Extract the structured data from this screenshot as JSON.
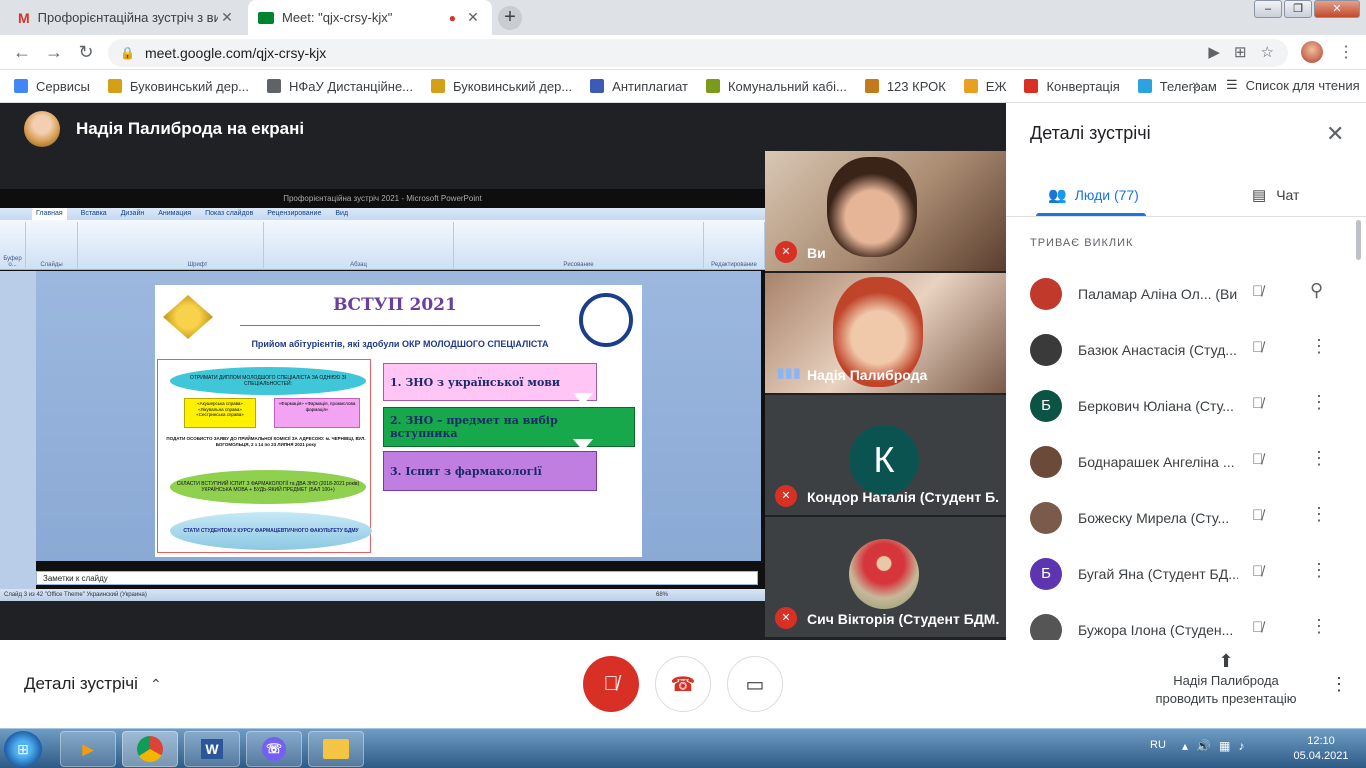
{
  "tabs": [
    {
      "title": "Профорієнтаційна зустріч з ви",
      "close": "✕"
    },
    {
      "title": "Meet: \"qjx-crsy-kjx\"",
      "close": "✕"
    }
  ],
  "new_tab": "+",
  "window_controls": {
    "minimize": "–",
    "maximize": "❐",
    "close": "✕"
  },
  "address": {
    "url": "meet.google.com/qjx-crsy-kjx"
  },
  "bookmarks": [
    {
      "label": "Сервисы",
      "icon": "apps-icon",
      "color": "#4285f4"
    },
    {
      "label": "Буковинський дер...",
      "icon": "university-icon",
      "color": "#d4a017"
    },
    {
      "label": "НФаУ Дистанційне...",
      "icon": "globe-icon",
      "color": "#5f6368"
    },
    {
      "label": "Буковинський дер...",
      "icon": "university-icon",
      "color": "#d4a017"
    },
    {
      "label": "Антиплагиат",
      "icon": "shield-icon",
      "color": "#3b5bb5"
    },
    {
      "label": "Комунальний кабі...",
      "icon": "pencil-icon",
      "color": "#7a9a1a"
    },
    {
      "label": "123 КРОК",
      "icon": "building-icon",
      "color": "#c47a1a"
    },
    {
      "label": "ЕЖ",
      "icon": "journal-icon",
      "color": "#e8a020"
    },
    {
      "label": "Конвертація",
      "icon": "heart-icon",
      "color": "#d93025"
    },
    {
      "label": "Телеграм",
      "icon": "telegram-icon",
      "color": "#2aa3e0"
    }
  ],
  "bookmarks_more": "»",
  "reading_list": "Список для чтения",
  "presenter": {
    "name": "Надія Палиброда на екрані"
  },
  "ppt": {
    "title": "Профорієнтаційна зустріч 2021 - Microsoft PowerPoint",
    "tabs": [
      "Главная",
      "Вставка",
      "Дизайн",
      "Анимация",
      "Показ слайдов",
      "Рецензирование",
      "Вид"
    ],
    "groups": [
      "Буфер о...",
      "Слайды",
      "Шрифт",
      "Абзац",
      "Рисование",
      "Редактирование"
    ],
    "notes": "Заметки к слайду",
    "status": "Слайд 3 из 42   \"Office Theme\"   Украинский (Украина)",
    "zoom": "68%"
  },
  "slide": {
    "title": "ВСТУП  2021",
    "subtitle": "Прийом абітурієнтів, які здобули ОКР МОЛОДШОГО СПЕЦІАЛІСТА",
    "oval1": "ОТРИМАТИ ДИПЛОМ МОЛОДШОГО СПЕЦІАЛІСТА ЗА ОДНІЄЮ ЗІ СПЕЦІАЛЬНОСТЕЙ:",
    "yellow": "«Акушерська справа» «Лікувальна справа» «Сестринська справа»",
    "pink": "«Фармація» «Фармація, промислова фармація»",
    "apply": "ПОДАТИ ОСОБИСТО ЗАЯВУ ДО ПРИЙМАЛЬНОЇ КОМІСІЇ ЗА АДРЕСОЮ: м. ЧЕРНІВЦІ, ВУЛ. БОГОМОЛЬЦЯ, 2 з 14 по 23 ЛИПНЯ 2021 року",
    "oval2": "СКЛАСТИ ВСТУПНИЙ ІСПИТ З ФАРМАКОЛОГІЇ та ДВА ЗНО (2018-2021 років) УКРАЇНСЬКА МОВА + БУДЬ-ЯКИЙ ПРЕДМЕТ (БАЛ 100+)",
    "oval3": "СТАТИ СТУДЕНТОМ 2 КУРСУ ФАРМАЦЕВТИЧНОГО ФАКУЛЬТЕТУ БДМУ",
    "step1": "1. ЗНО з української мови",
    "step2": "2. ЗНО – предмет на вибір вступника",
    "step3": "3. Іспит з фармакології"
  },
  "tiles": [
    {
      "name": "Ви",
      "muted": true
    },
    {
      "name": "Надія Палиброда",
      "muted": false
    },
    {
      "name": "Кондор Наталія (Студент Б...",
      "initial": "К",
      "muted": true
    },
    {
      "name": "Сич Вікторія (Студент БДМ...",
      "muted": true
    }
  ],
  "panel": {
    "title": "Деталі зустрічі",
    "people_tab": "Люди (77)",
    "chat_tab": "Чат",
    "in_call": "ТРИВАЄ ВИКЛИК",
    "participants": [
      {
        "name": "Паламар Аліна Ол... (Ви)",
        "initial": "",
        "color": "#c0392b",
        "action": "pin-icon"
      },
      {
        "name": "Базюк Анастасія (Студ...",
        "initial": "",
        "color": "#3a3a3a",
        "action": "more-icon"
      },
      {
        "name": "Беркович Юліана (Сту...",
        "initial": "Б",
        "color": "#0b5345",
        "action": "more-icon"
      },
      {
        "name": "Боднарашек Ангеліна ...",
        "initial": "",
        "color": "#6b4a3a",
        "action": "more-icon"
      },
      {
        "name": "Божеску Мирела (Сту...",
        "initial": "",
        "color": "#7a5a4a",
        "action": "more-icon"
      },
      {
        "name": "Бугай Яна (Студент БД...",
        "initial": "Б",
        "color": "#5e35b1",
        "action": "more-icon"
      },
      {
        "name": "Бужора Ілона (Студен...",
        "initial": "",
        "color": "#555",
        "action": "more-icon"
      }
    ]
  },
  "bottom": {
    "details": "Деталі зустрічі",
    "presenting_line1": "Надія Палиброда",
    "presenting_line2": "проводить презентацію"
  },
  "taskbar": {
    "lang": "RU",
    "time": "12:10",
    "date": "05.04.2021"
  }
}
